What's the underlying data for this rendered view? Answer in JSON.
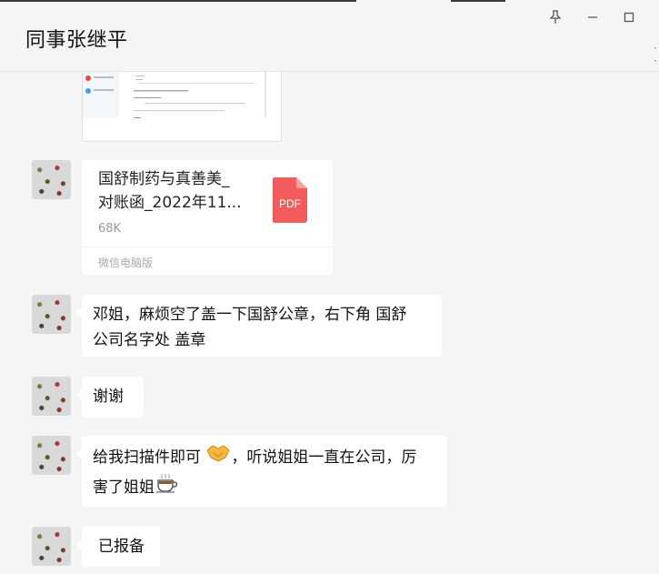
{
  "window": {
    "title": "同事张继平",
    "pin_icon": "pin-icon",
    "minimize_icon": "minimize-icon",
    "maximize_icon": "maximize-icon"
  },
  "messages": [
    {
      "type": "image",
      "content": "screenshot-thumbnail"
    },
    {
      "type": "file",
      "filename_line1": "国舒制药与真善美_",
      "filename_line2": "对账函_2022年11...",
      "size": "68K",
      "source": "微信电脑版",
      "icon": "pdf-icon",
      "icon_label": "PDF",
      "icon_color": "#f25c5c"
    },
    {
      "type": "text",
      "line1": "邓姐，麻烦空了盖一下国舒公章，右下角 国舒",
      "line2": "公司名字处 盖章"
    },
    {
      "type": "text",
      "line1": "谢谢"
    },
    {
      "type": "text",
      "line1_pre": "给我扫描件即可 ",
      "line1_post": "，听说姐姐一直在公司，厉",
      "line2": "害了姐姐",
      "emoji1": "handshake-emoji",
      "emoji2": "coffee-emoji"
    },
    {
      "type": "text",
      "line1": "已报备"
    }
  ]
}
